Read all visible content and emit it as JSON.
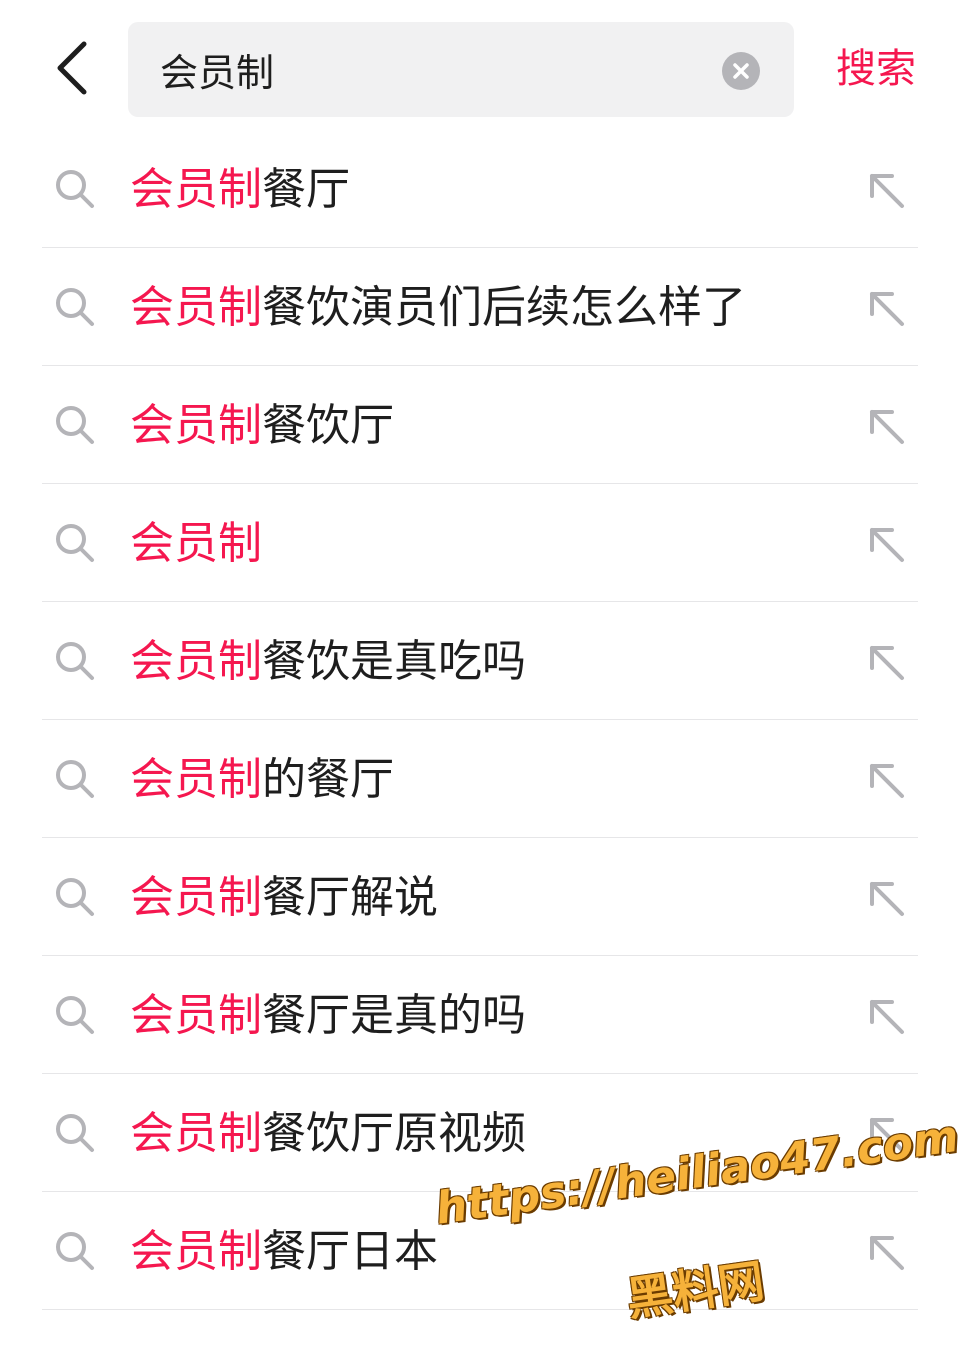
{
  "header": {
    "back_icon": "chevron-left-icon",
    "search": {
      "value": "会员制",
      "placeholder": ""
    },
    "clear_icon": "close-circle-icon",
    "search_action_label": "搜索"
  },
  "colors": {
    "accent": "#f5174f",
    "text": "#1e1e1e",
    "icon": "#b4b4b8",
    "divider": "#e6e6e8",
    "search_bg": "#f1f1f2"
  },
  "suggestions": [
    {
      "highlight": "会员制",
      "rest": "餐厅"
    },
    {
      "highlight": "会员制",
      "rest": "餐饮演员们后续怎么样了"
    },
    {
      "highlight": "会员制",
      "rest": "餐饮厅"
    },
    {
      "highlight": "会员制",
      "rest": ""
    },
    {
      "highlight": "会员制",
      "rest": "餐饮是真吃吗"
    },
    {
      "highlight": "会员制",
      "rest": "的餐厅"
    },
    {
      "highlight": "会员制",
      "rest": "餐厅解说"
    },
    {
      "highlight": "会员制",
      "rest": "餐厅是真的吗"
    },
    {
      "highlight": "会员制",
      "rest": "餐饮厅原视频"
    },
    {
      "highlight": "会员制",
      "rest": "餐厅日本"
    }
  ],
  "suggestion_icons": {
    "leading": "search-icon",
    "trailing": "arrow-up-left-icon"
  },
  "watermark": {
    "url": "https://heiliao47.com",
    "name": "黑料网"
  }
}
